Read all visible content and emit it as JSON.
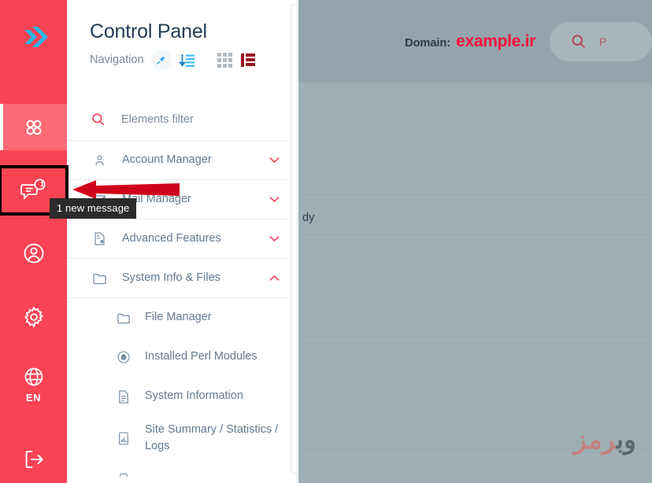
{
  "rail": {
    "logo_icon": "double-chevron-logo",
    "items": [
      {
        "icon": "grid-apps-icon",
        "label": "",
        "active": true
      },
      {
        "icon": "message-bubble-icon",
        "label": "",
        "badge": "1",
        "focused": true
      },
      {
        "icon": "user-circle-icon",
        "label": ""
      },
      {
        "icon": "gear-icon",
        "label": ""
      },
      {
        "icon": "globe-icon",
        "label": "EN"
      },
      {
        "icon": "logout-icon",
        "label": ""
      }
    ]
  },
  "panel": {
    "title": "Control Panel",
    "subtitle": "Navigation",
    "pin_icon": "pin-icon",
    "sort_icon": "sort-descending-icon",
    "grid_view_icon": "grid-view-icon",
    "list_view_icon": "list-view-icon",
    "filter": {
      "icon": "search-icon",
      "placeholder": "Elements filter",
      "value": ""
    },
    "groups": [
      {
        "icon": "person-icon",
        "label": "Account Manager",
        "chevron": "chevron-down-icon",
        "expanded": false
      },
      {
        "icon": "envelope-icon",
        "label": "Mail Manager",
        "chevron": "chevron-down-icon",
        "expanded": false
      },
      {
        "icon": "file-gear-icon",
        "label": "Advanced Features",
        "chevron": "chevron-down-icon",
        "expanded": false
      },
      {
        "icon": "folder-icon",
        "label": "System Info & Files",
        "chevron": "chevron-up-icon",
        "expanded": true
      }
    ],
    "subitems": [
      {
        "icon": "folder-icon",
        "label": "File Manager"
      },
      {
        "icon": "perl-icon",
        "label": "Installed Perl Modules"
      },
      {
        "icon": "document-icon",
        "label": "System Information"
      },
      {
        "icon": "chart-icon",
        "label": "Site Summary / Statistics / Logs"
      }
    ]
  },
  "content": {
    "domain_label": "Domain:",
    "domain_value": "example.ir",
    "search": {
      "icon": "search-icon",
      "placeholder": "P",
      "value": ""
    },
    "row_fragment": "dy",
    "watermark_dark": "وب",
    "watermark_red": "رمز"
  },
  "annotation": {
    "tooltip_text": "1 new message",
    "arrow_icon": "left-pointing-arrow",
    "arrow_color": "#d0021b",
    "highlight_color": "#000000"
  },
  "colors": {
    "rail_bg": "#fb4453",
    "rail_active": "#fc6b76",
    "logo_blue": "#29b6e8",
    "accent_red": "#fb0d3e",
    "panel_text": "#62798f",
    "title_text": "#243b53",
    "overlay": "#9eafb4"
  }
}
